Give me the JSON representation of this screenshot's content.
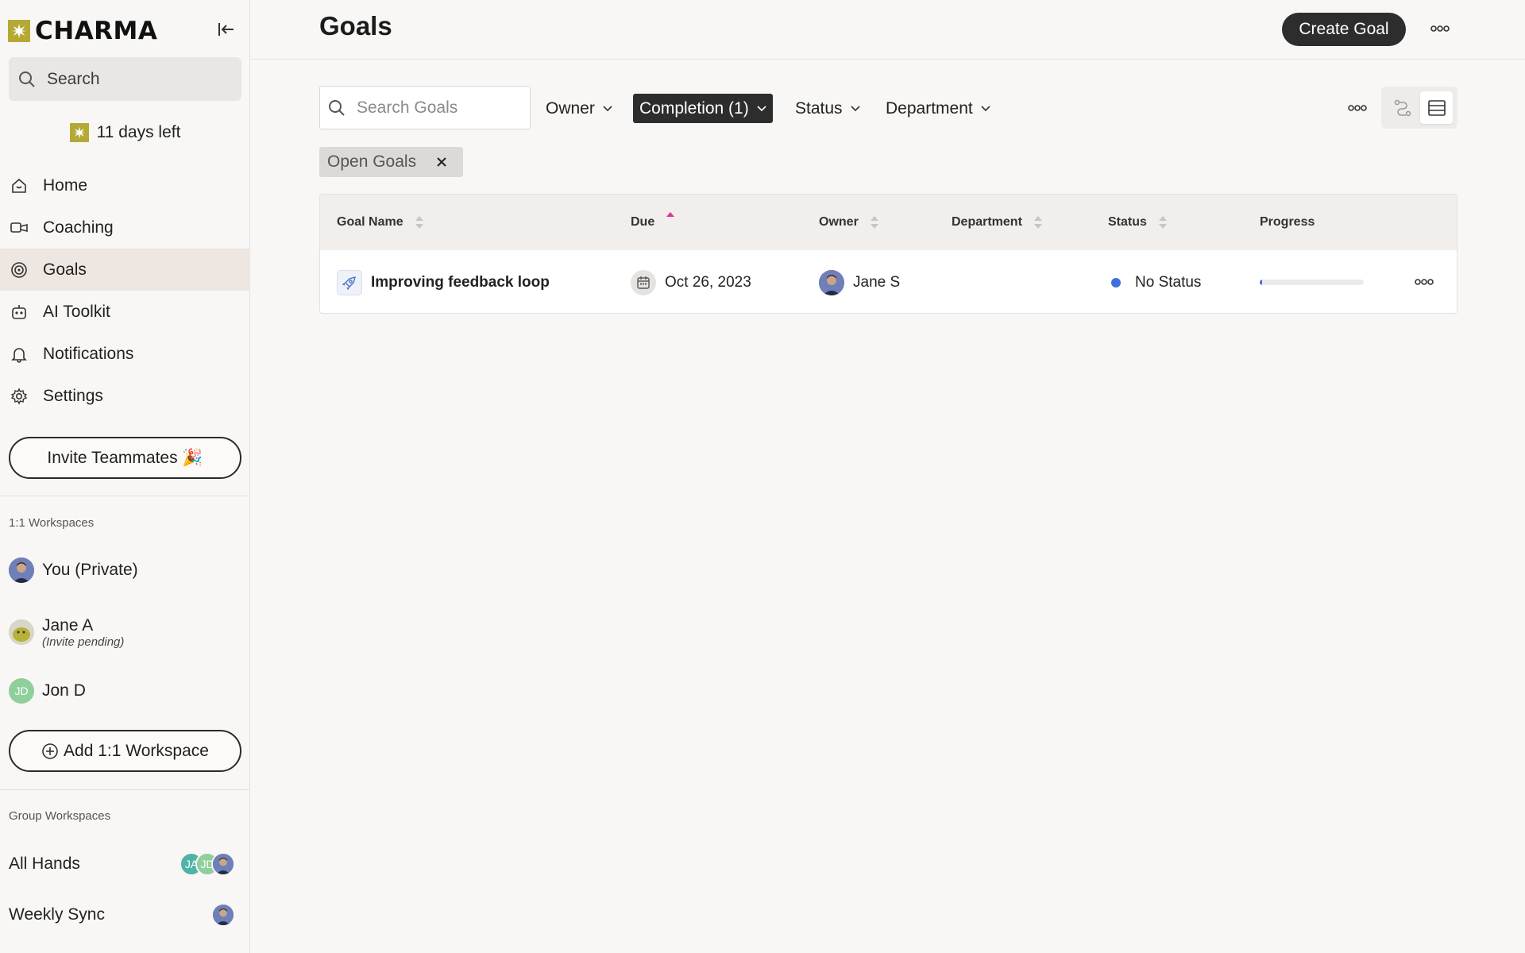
{
  "app": {
    "brand": "CHARMA",
    "trial_text": "11 days left"
  },
  "sidebar": {
    "search_label": "Search",
    "nav": [
      {
        "label": "Home",
        "icon": "home-icon"
      },
      {
        "label": "Coaching",
        "icon": "coaching-icon"
      },
      {
        "label": "Goals",
        "icon": "goals-icon",
        "active": true
      },
      {
        "label": "AI Toolkit",
        "icon": "robot-icon"
      },
      {
        "label": "Notifications",
        "icon": "bell-icon"
      },
      {
        "label": "Settings",
        "icon": "gear-icon"
      }
    ],
    "invite_label": "Invite Teammates 🎉",
    "workspaces_heading": "1:1 Workspaces",
    "workspaces": [
      {
        "name": "You (Private)"
      },
      {
        "name": "Jane A",
        "sub": "(Invite pending)"
      },
      {
        "name": "Jon D",
        "initials": "JD"
      }
    ],
    "add_workspace_label": "Add 1:1 Workspace",
    "groups_heading": "Group Workspaces",
    "groups": [
      {
        "name": "All Hands",
        "avatars": [
          "JA",
          "JD",
          "photo"
        ]
      },
      {
        "name": "Weekly Sync",
        "avatars": [
          "photo"
        ]
      }
    ]
  },
  "header": {
    "title": "Goals",
    "create_label": "Create Goal"
  },
  "filters": {
    "search_placeholder": "Search Goals",
    "owner": "Owner",
    "completion": "Completion (1)",
    "status": "Status",
    "department": "Department",
    "active_chip": "Open Goals"
  },
  "table": {
    "columns": [
      "Goal Name",
      "Due",
      "Owner",
      "Department",
      "Status",
      "Progress"
    ],
    "rows": [
      {
        "goal": "Improving feedback loop",
        "due": "Oct 26, 2023",
        "owner": "Jane S",
        "department": "",
        "status": "No Status",
        "progress_fraction": 0.02
      }
    ]
  },
  "colors": {
    "brand": "#b5a935",
    "accent_dark": "#2d2d2d",
    "status_blue": "#3e6fdb",
    "sort_active": "#d6399a"
  }
}
